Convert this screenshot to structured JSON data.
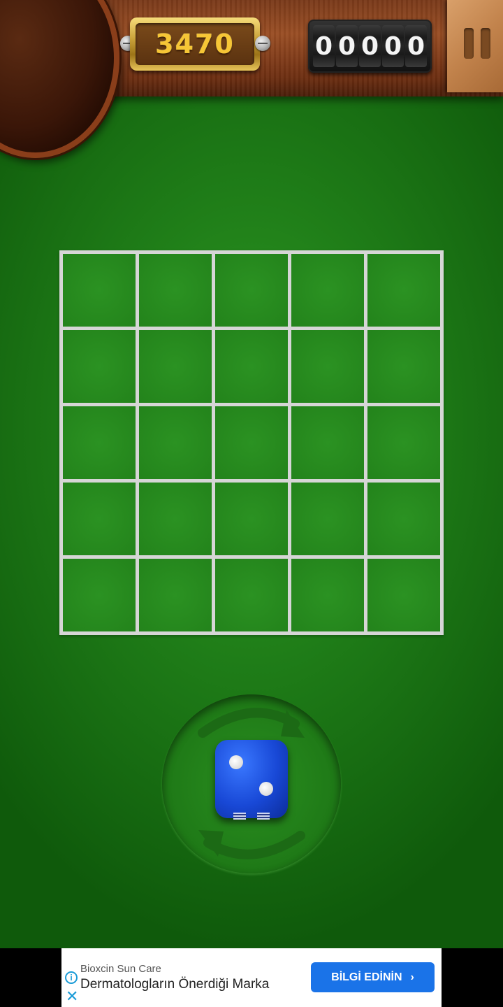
{
  "game": {
    "score": "3470",
    "counter_digits": [
      "0",
      "0",
      "0",
      "0",
      "0"
    ],
    "board": {
      "rows": 5,
      "cols": 5
    },
    "die": {
      "face_value": 2,
      "color": "#1848d6"
    },
    "colors": {
      "felt": "#23831b",
      "grid_lines": "#d6d6d6",
      "wood": "#8a421c",
      "score_text": "#f6c636"
    }
  },
  "ad": {
    "brand": "Bioxcin Sun Care",
    "headline": "Dermatologların Önerdiği Marka",
    "cta_label": "BİLGİ EDİNİN",
    "cta_color": "#1a73e8"
  }
}
